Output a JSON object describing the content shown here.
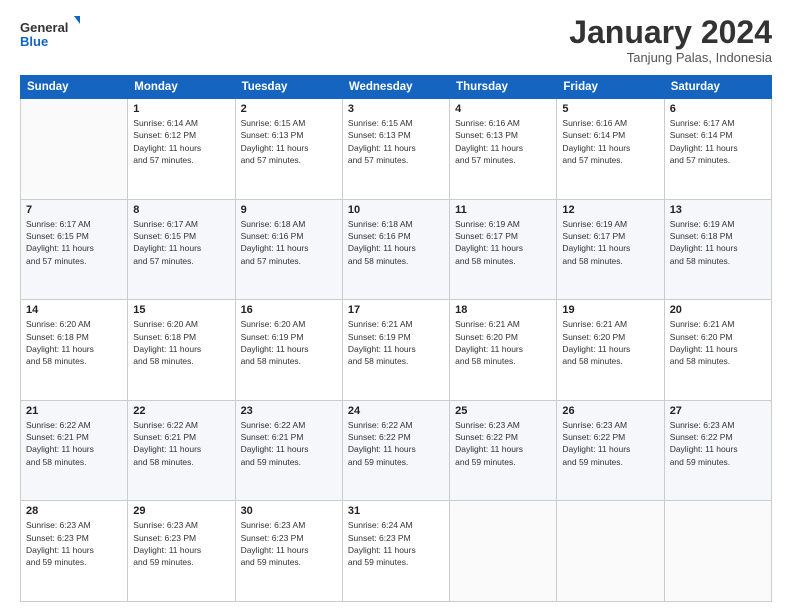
{
  "logo": {
    "line1": "General",
    "line2": "Blue"
  },
  "header": {
    "month": "January 2024",
    "location": "Tanjung Palas, Indonesia"
  },
  "weekdays": [
    "Sunday",
    "Monday",
    "Tuesday",
    "Wednesday",
    "Thursday",
    "Friday",
    "Saturday"
  ],
  "weeks": [
    [
      {
        "day": "",
        "info": ""
      },
      {
        "day": "1",
        "info": "Sunrise: 6:14 AM\nSunset: 6:12 PM\nDaylight: 11 hours\nand 57 minutes."
      },
      {
        "day": "2",
        "info": "Sunrise: 6:15 AM\nSunset: 6:13 PM\nDaylight: 11 hours\nand 57 minutes."
      },
      {
        "day": "3",
        "info": "Sunrise: 6:15 AM\nSunset: 6:13 PM\nDaylight: 11 hours\nand 57 minutes."
      },
      {
        "day": "4",
        "info": "Sunrise: 6:16 AM\nSunset: 6:13 PM\nDaylight: 11 hours\nand 57 minutes."
      },
      {
        "day": "5",
        "info": "Sunrise: 6:16 AM\nSunset: 6:14 PM\nDaylight: 11 hours\nand 57 minutes."
      },
      {
        "day": "6",
        "info": "Sunrise: 6:17 AM\nSunset: 6:14 PM\nDaylight: 11 hours\nand 57 minutes."
      }
    ],
    [
      {
        "day": "7",
        "info": "Sunrise: 6:17 AM\nSunset: 6:15 PM\nDaylight: 11 hours\nand 57 minutes."
      },
      {
        "day": "8",
        "info": "Sunrise: 6:17 AM\nSunset: 6:15 PM\nDaylight: 11 hours\nand 57 minutes."
      },
      {
        "day": "9",
        "info": "Sunrise: 6:18 AM\nSunset: 6:16 PM\nDaylight: 11 hours\nand 57 minutes."
      },
      {
        "day": "10",
        "info": "Sunrise: 6:18 AM\nSunset: 6:16 PM\nDaylight: 11 hours\nand 58 minutes."
      },
      {
        "day": "11",
        "info": "Sunrise: 6:19 AM\nSunset: 6:17 PM\nDaylight: 11 hours\nand 58 minutes."
      },
      {
        "day": "12",
        "info": "Sunrise: 6:19 AM\nSunset: 6:17 PM\nDaylight: 11 hours\nand 58 minutes."
      },
      {
        "day": "13",
        "info": "Sunrise: 6:19 AM\nSunset: 6:18 PM\nDaylight: 11 hours\nand 58 minutes."
      }
    ],
    [
      {
        "day": "14",
        "info": "Sunrise: 6:20 AM\nSunset: 6:18 PM\nDaylight: 11 hours\nand 58 minutes."
      },
      {
        "day": "15",
        "info": "Sunrise: 6:20 AM\nSunset: 6:18 PM\nDaylight: 11 hours\nand 58 minutes."
      },
      {
        "day": "16",
        "info": "Sunrise: 6:20 AM\nSunset: 6:19 PM\nDaylight: 11 hours\nand 58 minutes."
      },
      {
        "day": "17",
        "info": "Sunrise: 6:21 AM\nSunset: 6:19 PM\nDaylight: 11 hours\nand 58 minutes."
      },
      {
        "day": "18",
        "info": "Sunrise: 6:21 AM\nSunset: 6:20 PM\nDaylight: 11 hours\nand 58 minutes."
      },
      {
        "day": "19",
        "info": "Sunrise: 6:21 AM\nSunset: 6:20 PM\nDaylight: 11 hours\nand 58 minutes."
      },
      {
        "day": "20",
        "info": "Sunrise: 6:21 AM\nSunset: 6:20 PM\nDaylight: 11 hours\nand 58 minutes."
      }
    ],
    [
      {
        "day": "21",
        "info": "Sunrise: 6:22 AM\nSunset: 6:21 PM\nDaylight: 11 hours\nand 58 minutes."
      },
      {
        "day": "22",
        "info": "Sunrise: 6:22 AM\nSunset: 6:21 PM\nDaylight: 11 hours\nand 58 minutes."
      },
      {
        "day": "23",
        "info": "Sunrise: 6:22 AM\nSunset: 6:21 PM\nDaylight: 11 hours\nand 59 minutes."
      },
      {
        "day": "24",
        "info": "Sunrise: 6:22 AM\nSunset: 6:22 PM\nDaylight: 11 hours\nand 59 minutes."
      },
      {
        "day": "25",
        "info": "Sunrise: 6:23 AM\nSunset: 6:22 PM\nDaylight: 11 hours\nand 59 minutes."
      },
      {
        "day": "26",
        "info": "Sunrise: 6:23 AM\nSunset: 6:22 PM\nDaylight: 11 hours\nand 59 minutes."
      },
      {
        "day": "27",
        "info": "Sunrise: 6:23 AM\nSunset: 6:22 PM\nDaylight: 11 hours\nand 59 minutes."
      }
    ],
    [
      {
        "day": "28",
        "info": "Sunrise: 6:23 AM\nSunset: 6:23 PM\nDaylight: 11 hours\nand 59 minutes."
      },
      {
        "day": "29",
        "info": "Sunrise: 6:23 AM\nSunset: 6:23 PM\nDaylight: 11 hours\nand 59 minutes."
      },
      {
        "day": "30",
        "info": "Sunrise: 6:23 AM\nSunset: 6:23 PM\nDaylight: 11 hours\nand 59 minutes."
      },
      {
        "day": "31",
        "info": "Sunrise: 6:24 AM\nSunset: 6:23 PM\nDaylight: 11 hours\nand 59 minutes."
      },
      {
        "day": "",
        "info": ""
      },
      {
        "day": "",
        "info": ""
      },
      {
        "day": "",
        "info": ""
      }
    ]
  ]
}
